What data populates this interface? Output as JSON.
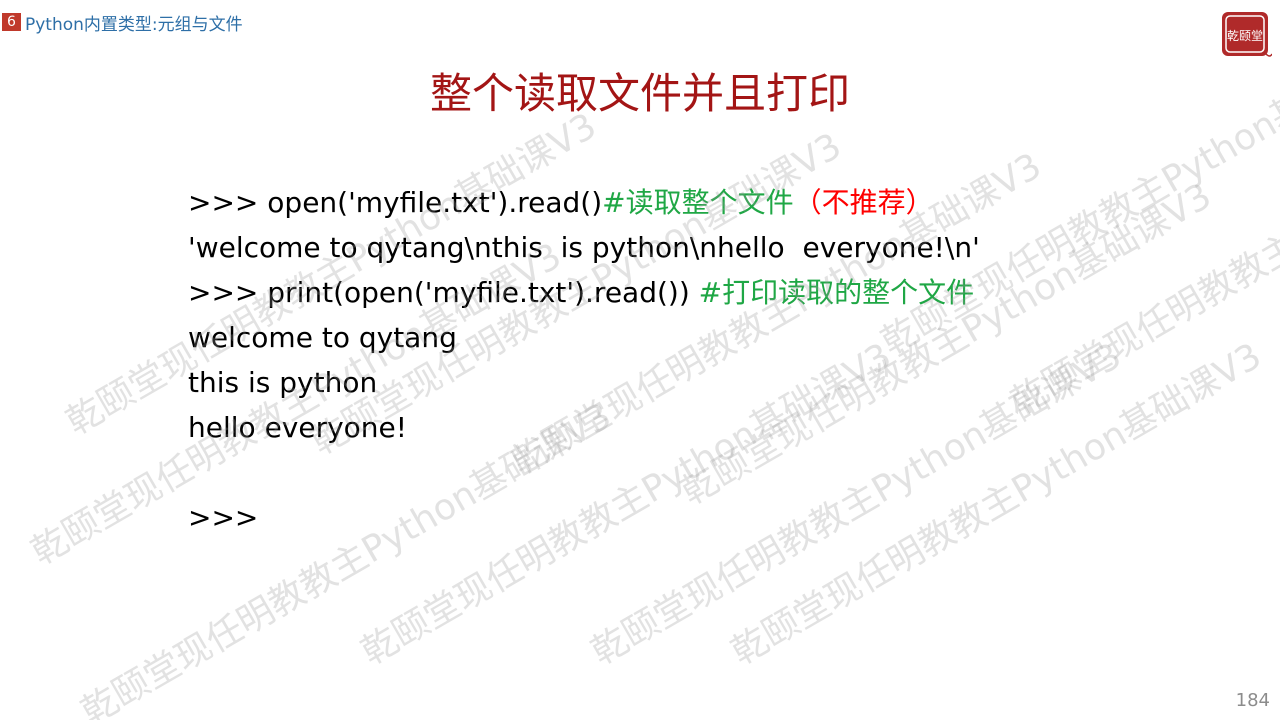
{
  "header": {
    "section_number": "6",
    "section_title": "Python内置类型:元组与文件",
    "logo_text": "乾颐堂"
  },
  "slide": {
    "title": "整个读取文件并且打印",
    "lines": [
      {
        "segments": [
          {
            "text": ">>> open('myfile.txt').read()",
            "style": "code"
          },
          {
            "text": "#读取整个文件",
            "style": "green"
          },
          {
            "text": "（不推荐）",
            "style": "red"
          }
        ]
      },
      {
        "segments": [
          {
            "text": "'welcome to qytang\\nthis  is python\\nhello  everyone!\\n'",
            "style": "code"
          }
        ]
      },
      {
        "segments": [
          {
            "text": ">>> print(open('myfile.txt').read()) ",
            "style": "code"
          },
          {
            "text": "#打印读取的整个文件",
            "style": "green"
          }
        ]
      },
      {
        "segments": [
          {
            "text": "welcome to qytang",
            "style": "code"
          }
        ]
      },
      {
        "segments": [
          {
            "text": "this is python",
            "style": "code"
          }
        ]
      },
      {
        "segments": [
          {
            "text": "hello everyone!",
            "style": "code"
          }
        ]
      },
      {
        "segments": [
          {
            "text": "",
            "style": "code"
          }
        ]
      },
      {
        "segments": [
          {
            "text": ">>>",
            "style": "code"
          }
        ]
      }
    ]
  },
  "watermark": {
    "text": "乾颐堂现任明教教主Python基础课V3"
  },
  "footer": {
    "page_number": "184"
  },
  "colors": {
    "title": "#a31515",
    "comment_green": "#1fa745",
    "comment_red": "#ff0000",
    "section_badge": "#c0392b",
    "section_text": "#2e6fa7"
  }
}
